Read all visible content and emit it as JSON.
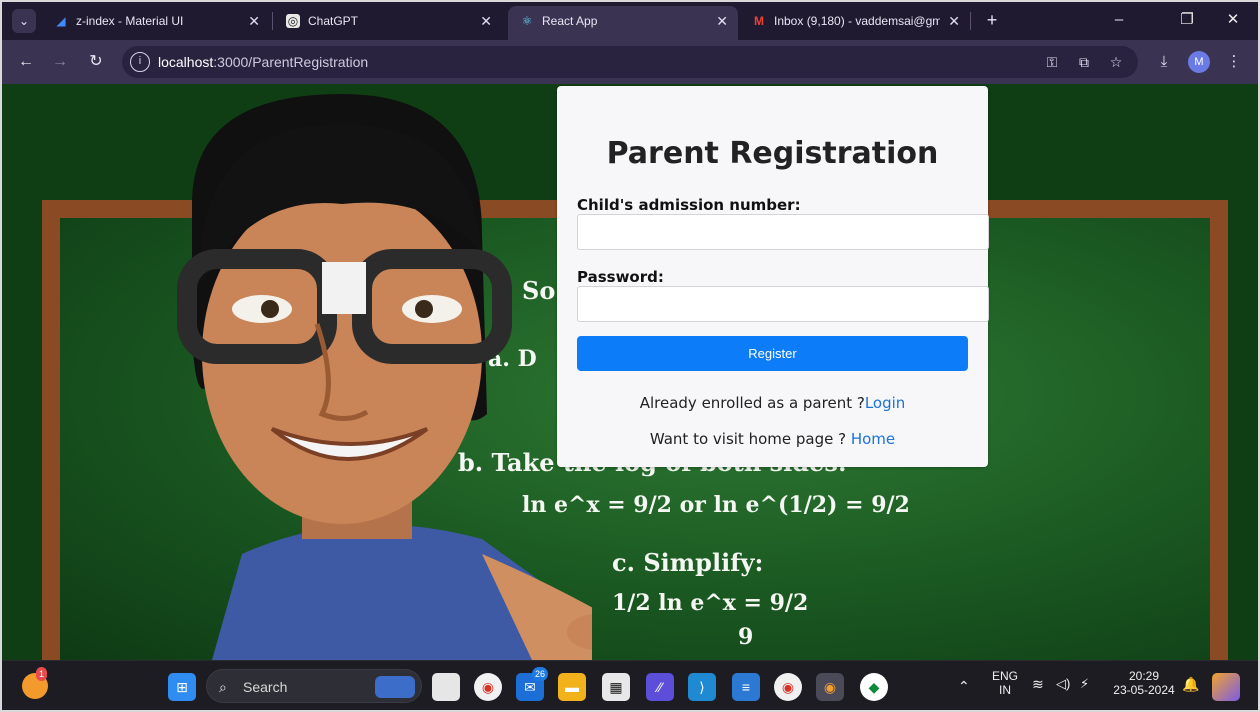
{
  "browser": {
    "tabs": [
      {
        "title": "z-index - Material UI",
        "icon": "material-ui-logo"
      },
      {
        "title": "ChatGPT",
        "icon": "chatgpt-logo"
      },
      {
        "title": "React App",
        "icon": "react-logo",
        "active": true
      },
      {
        "title": "Inbox (9,180) - vaddemsai@gm",
        "icon": "gmail-logo"
      }
    ],
    "url_host": "localhost",
    "url_path": ":3000/ParentRegistration",
    "profile_initial": "M"
  },
  "form": {
    "title": "Parent Registration",
    "admission_label": "Child's admission number:",
    "password_label": "Password:",
    "register_label": "Register",
    "login_prompt": "Already enrolled as a parent ?",
    "login_link": "Login",
    "home_prompt": "Want to visit home page ? ",
    "home_link": "Home",
    "primary_color": "#0d7cf9",
    "link_color": "#1a73d9"
  },
  "background": {
    "chalk_lines": [
      "So",
      "a. D",
      "b. Take the log of both sides:",
      "ln e^x = 9/2  or  ln e^(1/2) = 9/2",
      "c. Simplify:",
      "1/2 ln e^x = 9/2",
      "9"
    ]
  },
  "taskbar": {
    "search_label": "Search",
    "mail_badge": "26",
    "notification_badge": "1",
    "language_primary": "ENG",
    "language_secondary": "IN",
    "time": "20:29",
    "date": "23-05-2024"
  }
}
